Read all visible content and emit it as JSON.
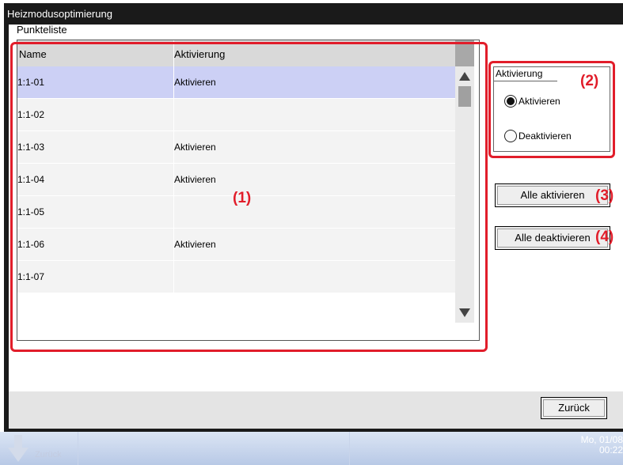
{
  "window": {
    "title": "Heizmodusoptimierung"
  },
  "list": {
    "label": "Punkteliste",
    "columns": [
      "Name",
      "Aktivierung"
    ],
    "rows": [
      {
        "name": "1:1-01",
        "activation": "Aktivieren",
        "selected": true
      },
      {
        "name": "1:1-02",
        "activation": "",
        "selected": false
      },
      {
        "name": "1:1-03",
        "activation": "Aktivieren",
        "selected": false
      },
      {
        "name": "1:1-04",
        "activation": "Aktivieren",
        "selected": false
      },
      {
        "name": "1:1-05",
        "activation": "",
        "selected": false
      },
      {
        "name": "1:1-06",
        "activation": "Aktivieren",
        "selected": false
      },
      {
        "name": "1:1-07",
        "activation": "",
        "selected": false
      }
    ]
  },
  "activation": {
    "legend": "Aktivierung",
    "options": [
      "Aktivieren",
      "Deaktivieren"
    ],
    "selected": "Aktivieren"
  },
  "buttons": {
    "enable_all": "Alle aktivieren",
    "disable_all": "Alle deaktivieren",
    "back": "Zurück"
  },
  "annotations": [
    "(1)",
    "(2)",
    "(3)",
    "(4)"
  ],
  "taskbar": {
    "back_label": "Zurück",
    "date": "Mo, 01/08",
    "time": "00:22"
  },
  "colors": {
    "highlight": "#e11d2a",
    "selected_row": "#ccd0f5",
    "title_bar": "#1a1a1a"
  },
  "icons": {
    "scroll_up": "triangle-up-icon",
    "scroll_down": "triangle-down-icon",
    "taskbar_back": "arrow-down-icon"
  }
}
